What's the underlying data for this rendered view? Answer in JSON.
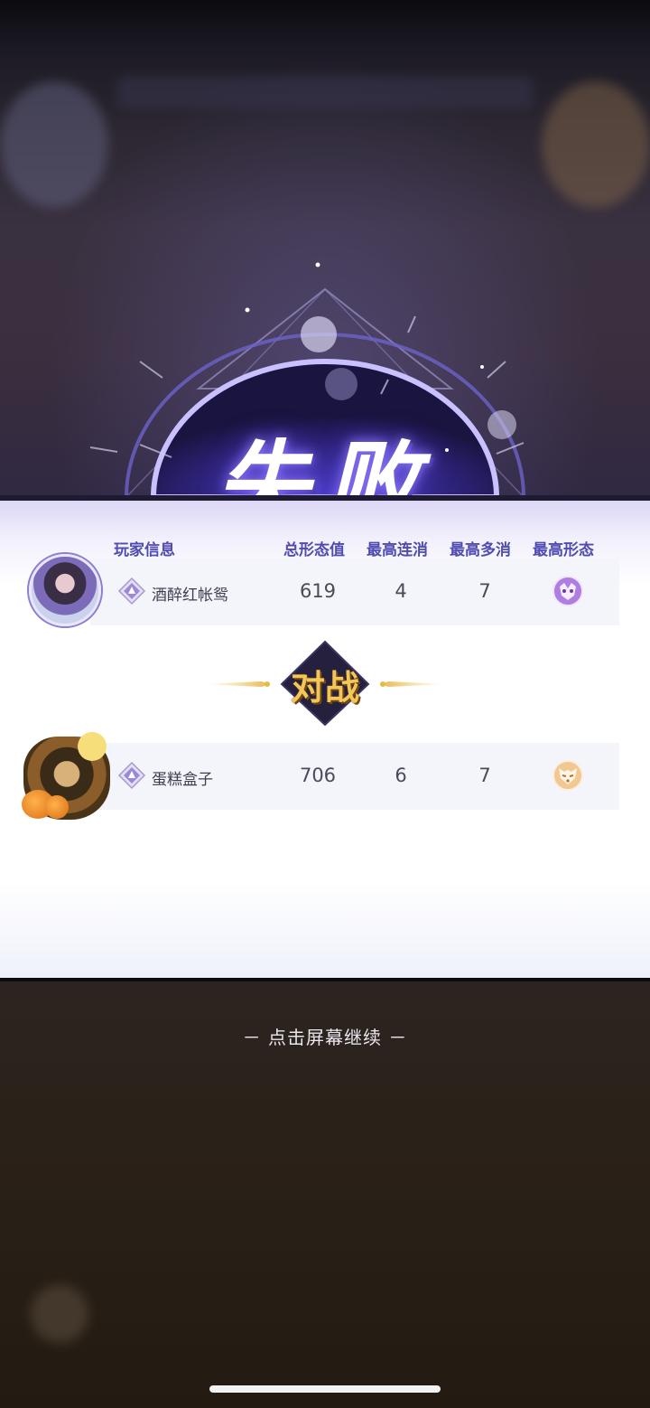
{
  "result": {
    "title": "失败"
  },
  "table": {
    "headers": [
      "玩家信息",
      "总形态值",
      "最高连消",
      "最高多消",
      "最高形态"
    ]
  },
  "players": [
    {
      "name": "酒醉红帐鸳",
      "total": "619",
      "max_combo": "4",
      "max_multi": "7",
      "form_icon": "purple-mask-icon"
    },
    {
      "name": "蛋糕盒子",
      "total": "706",
      "max_combo": "6",
      "max_multi": "7",
      "form_icon": "fox-mask-icon"
    }
  ],
  "vs": {
    "label": "对战"
  },
  "footer": {
    "continue": "－ 点击屏幕继续 －"
  },
  "colors": {
    "accent": "#4f4bb0",
    "gold": "#e8b84a",
    "title_glow": "#8e7cff"
  }
}
